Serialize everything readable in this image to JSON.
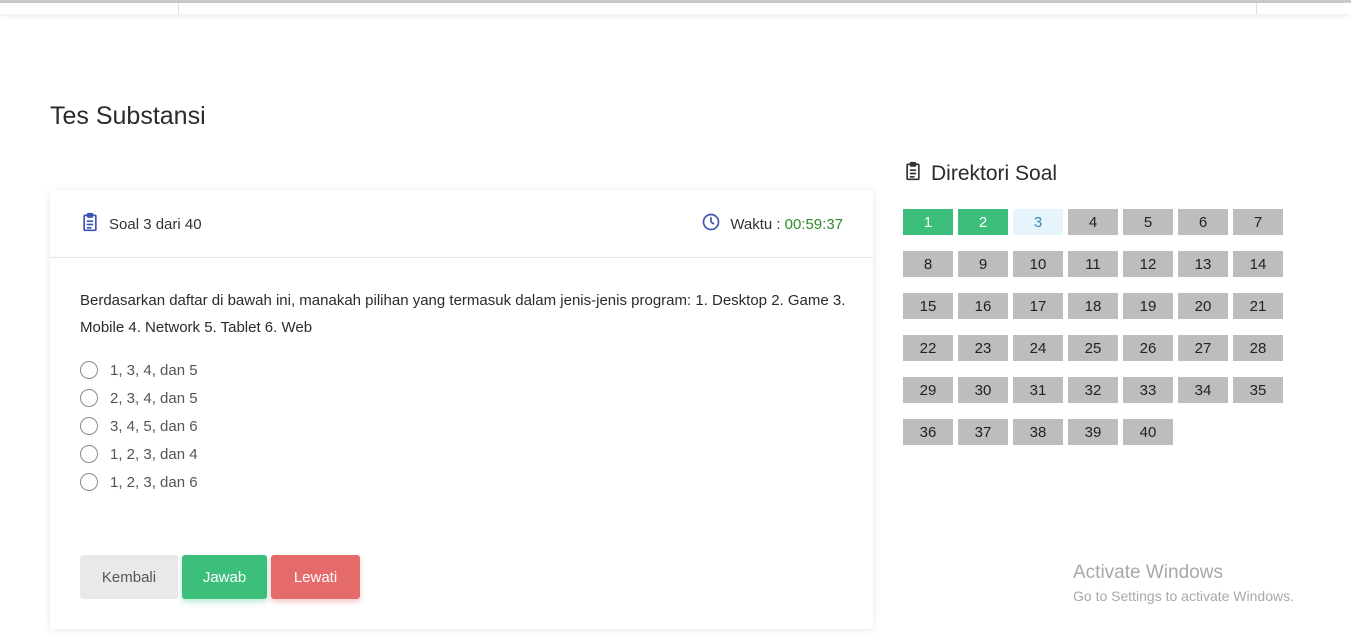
{
  "page": {
    "title": "Tes Substansi"
  },
  "card": {
    "question_count": "Soal 3 dari 40",
    "timer_label": "Waktu :",
    "timer_value": "00:59:37",
    "question_text": "Berdasarkan daftar di bawah ini, manakah pilihan yang termasuk dalam jenis-jenis program: 1. Desktop 2. Game 3. Mobile 4. Network 5. Tablet 6. Web",
    "options": [
      "1, 3, 4, dan 5",
      "2, 3, 4, dan 5",
      "3, 4, 5, dan 6",
      "1, 2, 3, dan 4",
      "1, 2, 3, dan 6"
    ],
    "buttons": {
      "back": "Kembali",
      "answer": "Jawab",
      "skip": "Lewati"
    }
  },
  "directory": {
    "title": "Direktori Soal",
    "questions": [
      {
        "n": "1",
        "state": "answered"
      },
      {
        "n": "2",
        "state": "answered"
      },
      {
        "n": "3",
        "state": "current"
      },
      {
        "n": "4",
        "state": "unanswered"
      },
      {
        "n": "5",
        "state": "unanswered"
      },
      {
        "n": "6",
        "state": "unanswered"
      },
      {
        "n": "7",
        "state": "unanswered"
      },
      {
        "n": "8",
        "state": "unanswered"
      },
      {
        "n": "9",
        "state": "unanswered"
      },
      {
        "n": "10",
        "state": "unanswered"
      },
      {
        "n": "11",
        "state": "unanswered"
      },
      {
        "n": "12",
        "state": "unanswered"
      },
      {
        "n": "13",
        "state": "unanswered"
      },
      {
        "n": "14",
        "state": "unanswered"
      },
      {
        "n": "15",
        "state": "unanswered"
      },
      {
        "n": "16",
        "state": "unanswered"
      },
      {
        "n": "17",
        "state": "unanswered"
      },
      {
        "n": "18",
        "state": "unanswered"
      },
      {
        "n": "19",
        "state": "unanswered"
      },
      {
        "n": "20",
        "state": "unanswered"
      },
      {
        "n": "21",
        "state": "unanswered"
      },
      {
        "n": "22",
        "state": "unanswered"
      },
      {
        "n": "23",
        "state": "unanswered"
      },
      {
        "n": "24",
        "state": "unanswered"
      },
      {
        "n": "25",
        "state": "unanswered"
      },
      {
        "n": "26",
        "state": "unanswered"
      },
      {
        "n": "27",
        "state": "unanswered"
      },
      {
        "n": "28",
        "state": "unanswered"
      },
      {
        "n": "29",
        "state": "unanswered"
      },
      {
        "n": "30",
        "state": "unanswered"
      },
      {
        "n": "31",
        "state": "unanswered"
      },
      {
        "n": "32",
        "state": "unanswered"
      },
      {
        "n": "33",
        "state": "unanswered"
      },
      {
        "n": "34",
        "state": "unanswered"
      },
      {
        "n": "35",
        "state": "unanswered"
      },
      {
        "n": "36",
        "state": "unanswered"
      },
      {
        "n": "37",
        "state": "unanswered"
      },
      {
        "n": "38",
        "state": "unanswered"
      },
      {
        "n": "39",
        "state": "unanswered"
      },
      {
        "n": "40",
        "state": "unanswered"
      }
    ]
  },
  "watermark": {
    "line1": "Activate Windows",
    "line2": "Go to Settings to activate Windows."
  },
  "icons": {
    "question_icon": "clipboard-list-icon",
    "timer_icon": "clock-icon",
    "directory_icon": "clipboard-list-icon"
  },
  "colors": {
    "answered": "#3cbf7a",
    "current": "#e6f5fb",
    "unanswered": "#bdbdbd",
    "skip": "#e56a6a",
    "timer": "#2e8b2e",
    "icon": "#3f51b5"
  }
}
